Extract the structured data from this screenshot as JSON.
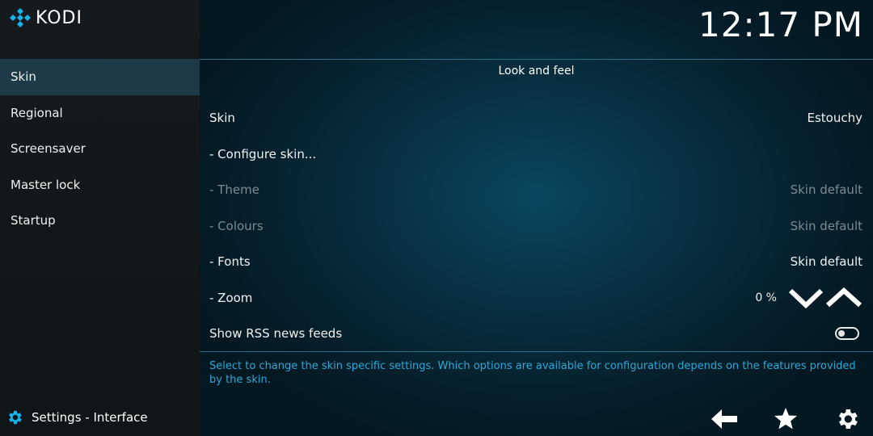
{
  "app": {
    "logo_text": "KODI"
  },
  "clock": "12:17 PM",
  "sidebar": {
    "items": [
      {
        "label": "Skin",
        "active": true
      },
      {
        "label": "Regional"
      },
      {
        "label": "Screensaver"
      },
      {
        "label": "Master lock"
      },
      {
        "label": "Startup"
      }
    ],
    "footer_label": "Settings - Interface"
  },
  "main": {
    "section_title": "Look and feel",
    "settings": [
      {
        "label": "Skin",
        "value": "Estouchy"
      },
      {
        "label": "- Configure skin...",
        "value": ""
      },
      {
        "label": "- Theme",
        "value": "Skin default",
        "disabled": true
      },
      {
        "label": "- Colours",
        "value": "Skin default",
        "disabled": true
      },
      {
        "label": "- Fonts",
        "value": "Skin default"
      },
      {
        "label": "- Zoom",
        "value": "0 %"
      },
      {
        "label": "Show RSS news feeds",
        "value": "off"
      }
    ],
    "help_text": "Select to change the skin specific settings. Which options are available for configuration depends on the features provided by the skin."
  },
  "colors": {
    "accent": "#2aa8d8",
    "active_bg": "#1e3a47",
    "disabled_text": "#7d8a90"
  },
  "icons": {
    "logo": "kodi-logo-icon",
    "settings": "gear-icon",
    "back": "back-arrow-icon",
    "favourites": "star-icon",
    "options": "gear-icon"
  }
}
